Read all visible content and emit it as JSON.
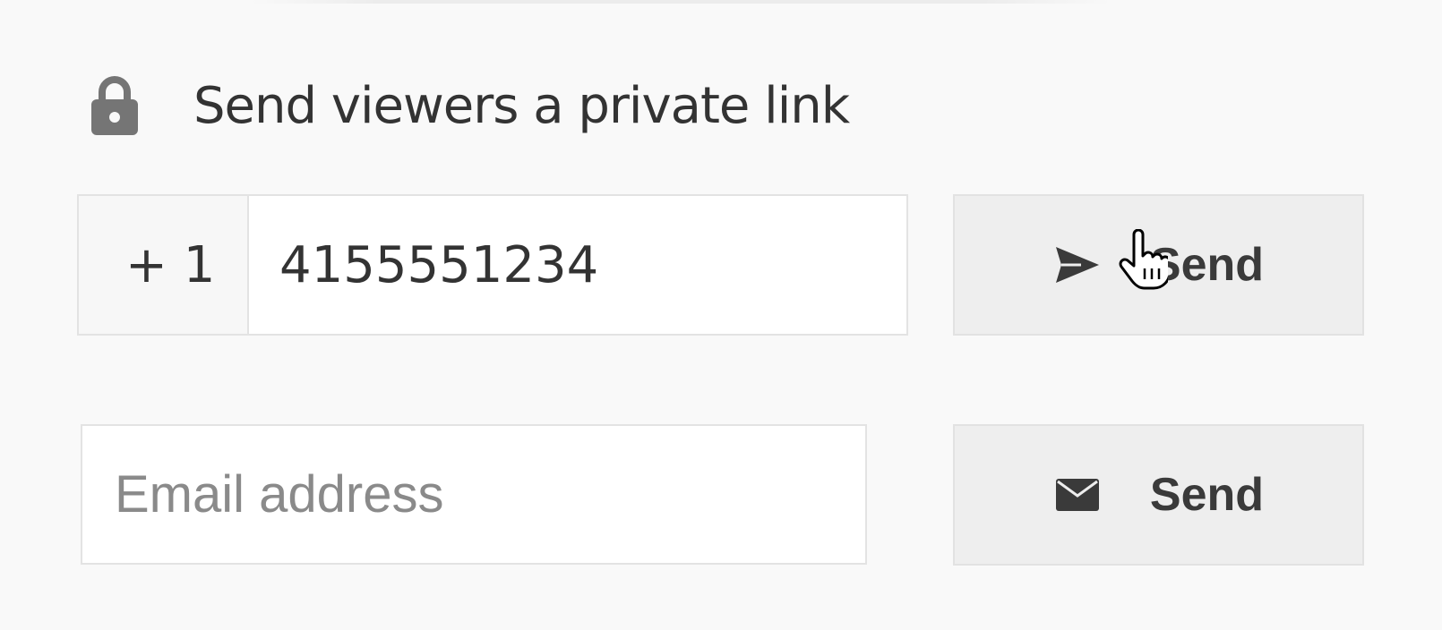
{
  "header": {
    "icon": "lock-icon",
    "text": "Send viewers a private link"
  },
  "sms": {
    "country_code": "+ 1",
    "phone_value": "4155551234",
    "send_icon": "paper-plane-icon",
    "send_label": "Send"
  },
  "email": {
    "placeholder": "Email address",
    "value": "",
    "send_icon": "envelope-icon",
    "send_label": "Send"
  },
  "colors": {
    "background": "#f9f9f9",
    "button_bg": "#eeeeee",
    "border": "#e3e3e3",
    "text": "#333333",
    "icon": "#757575"
  }
}
